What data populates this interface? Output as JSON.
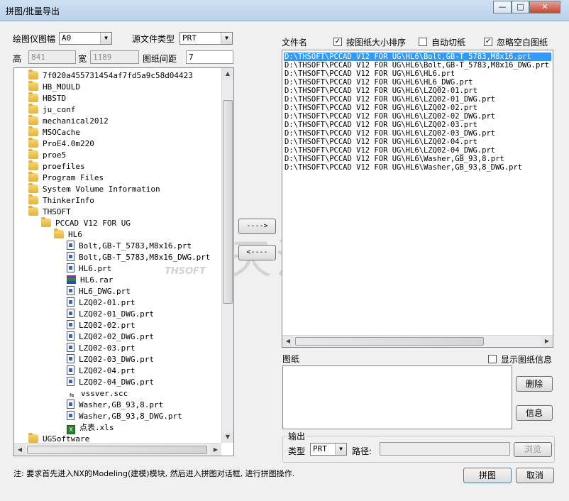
{
  "window": {
    "title": "拼图/批量导出",
    "minimize": "—",
    "restore": "□",
    "close": "✕"
  },
  "top": {
    "paper_size_label": "绘图仪图幅",
    "paper_size_value": "A0",
    "source_type_label": "源文件类型",
    "source_type_value": "PRT",
    "height_label": "高",
    "height_value": "841",
    "width_label": "宽",
    "width_value": "1189",
    "spacing_label": "图纸间距",
    "spacing_value": "7"
  },
  "tree": [
    {
      "label": "7f020a455731454af7fd5a9c58d04423",
      "icon": "folder",
      "indent": 0
    },
    {
      "label": "HB_MOULD",
      "icon": "folder",
      "indent": 0
    },
    {
      "label": "HBSTD",
      "icon": "folder",
      "indent": 0
    },
    {
      "label": "ju_conf",
      "icon": "folder",
      "indent": 0
    },
    {
      "label": "mechanical2012",
      "icon": "folder",
      "indent": 0
    },
    {
      "label": "MSOCache",
      "icon": "folder",
      "indent": 0
    },
    {
      "label": "ProE4.0m220",
      "icon": "folder",
      "indent": 0
    },
    {
      "label": "proe5",
      "icon": "folder",
      "indent": 0
    },
    {
      "label": "proefiles",
      "icon": "folder",
      "indent": 0
    },
    {
      "label": "Program Files",
      "icon": "folder",
      "indent": 0
    },
    {
      "label": "System Volume Information",
      "icon": "folder",
      "indent": 0
    },
    {
      "label": "ThinkerInfo",
      "icon": "folder",
      "indent": 0
    },
    {
      "label": "THSOFT",
      "icon": "folder",
      "indent": 0
    },
    {
      "label": "PCCAD V12 FOR UG",
      "icon": "folder",
      "indent": 1
    },
    {
      "label": "HL6",
      "icon": "folder",
      "indent": 2
    },
    {
      "label": "Bolt,GB-T_5783,M8x16.prt",
      "icon": "file",
      "indent": 3
    },
    {
      "label": "Bolt,GB-T_5783,M8x16_DWG.prt",
      "icon": "file",
      "indent": 3
    },
    {
      "label": "HL6.prt",
      "icon": "file",
      "indent": 3
    },
    {
      "label": "HL6.rar",
      "icon": "rar",
      "indent": 3
    },
    {
      "label": "HL6_DWG.prt",
      "icon": "file",
      "indent": 3
    },
    {
      "label": "LZQ02-01.prt",
      "icon": "file",
      "indent": 3
    },
    {
      "label": "LZQ02-01_DWG.prt",
      "icon": "file",
      "indent": 3
    },
    {
      "label": "LZQ02-02.prt",
      "icon": "file",
      "indent": 3
    },
    {
      "label": "LZQ02-02_DWG.prt",
      "icon": "file",
      "indent": 3
    },
    {
      "label": "LZQ02-03.prt",
      "icon": "file",
      "indent": 3
    },
    {
      "label": "LZQ02-03_DWG.prt",
      "icon": "file",
      "indent": 3
    },
    {
      "label": "LZQ02-04.prt",
      "icon": "file",
      "indent": 3
    },
    {
      "label": "LZQ02-04_DWG.prt",
      "icon": "file",
      "indent": 3
    },
    {
      "label": "vssver.scc",
      "icon": "scc",
      "indent": 3
    },
    {
      "label": "Washer,GB_93,8.prt",
      "icon": "file",
      "indent": 3
    },
    {
      "label": "Washer,GB_93,8_DWG.prt",
      "icon": "file",
      "indent": 3
    },
    {
      "label": "点表.xls",
      "icon": "xls",
      "indent": 3
    },
    {
      "label": "UGSoftware",
      "icon": "folder",
      "indent": 0
    }
  ],
  "middle": {
    "add_button": "---->",
    "remove_button": "<----"
  },
  "watermark": {
    "text": "天河软件",
    "sub": "THSOFT"
  },
  "right": {
    "files_label": "文件名",
    "sort_label": "按图纸大小排序",
    "sort_checked": "✓",
    "autocut_label": "自动切纸",
    "autocut_checked": "",
    "ignore_label": "忽略空白图纸",
    "ignore_checked": "✓",
    "files": [
      "D:\\THSOFT\\PCCAD V12 FOR UG\\HL6\\Bolt,GB-T_5783,M8x16.prt",
      "D:\\THSOFT\\PCCAD V12 FOR UG\\HL6\\Bolt,GB-T_5783,M8x16_DWG.prt",
      "D:\\THSOFT\\PCCAD V12 FOR UG\\HL6\\HL6.prt",
      "D:\\THSOFT\\PCCAD V12 FOR UG\\HL6\\HL6_DWG.prt",
      "D:\\THSOFT\\PCCAD V12 FOR UG\\HL6\\LZQ02-01.prt",
      "D:\\THSOFT\\PCCAD V12 FOR UG\\HL6\\LZQ02-01_DWG.prt",
      "D:\\THSOFT\\PCCAD V12 FOR UG\\HL6\\LZQ02-02.prt",
      "D:\\THSOFT\\PCCAD V12 FOR UG\\HL6\\LZQ02-02_DWG.prt",
      "D:\\THSOFT\\PCCAD V12 FOR UG\\HL6\\LZQ02-03.prt",
      "D:\\THSOFT\\PCCAD V12 FOR UG\\HL6\\LZQ02-03_DWG.prt",
      "D:\\THSOFT\\PCCAD V12 FOR UG\\HL6\\LZQ02-04.prt",
      "D:\\THSOFT\\PCCAD V12 FOR UG\\HL6\\LZQ02-04_DWG.prt",
      "D:\\THSOFT\\PCCAD V12 FOR UG\\HL6\\Washer,GB_93,8.prt",
      "D:\\THSOFT\\PCCAD V12 FOR UG\\HL6\\Washer,GB_93,8_DWG.prt"
    ],
    "drawing_label": "图纸",
    "show_info_label": "显示图纸信息",
    "show_info_checked": "",
    "delete_button": "删除",
    "info_button": "信息",
    "output_label": "输出",
    "type_label": "类型",
    "type_value": "PRT",
    "path_label": "路径:",
    "path_value": "",
    "browse_button": "浏览"
  },
  "footer": {
    "note": "注: 要求首先进入NX的Modeling(建模)模块, 然后进入拼图对话框, 进行拼图操作.",
    "ok_button": "拼图",
    "cancel_button": "取消"
  },
  "colors": {
    "selection": "#3399ff",
    "titlebar": "#b9d1ea",
    "folder": "#e3b13b"
  }
}
